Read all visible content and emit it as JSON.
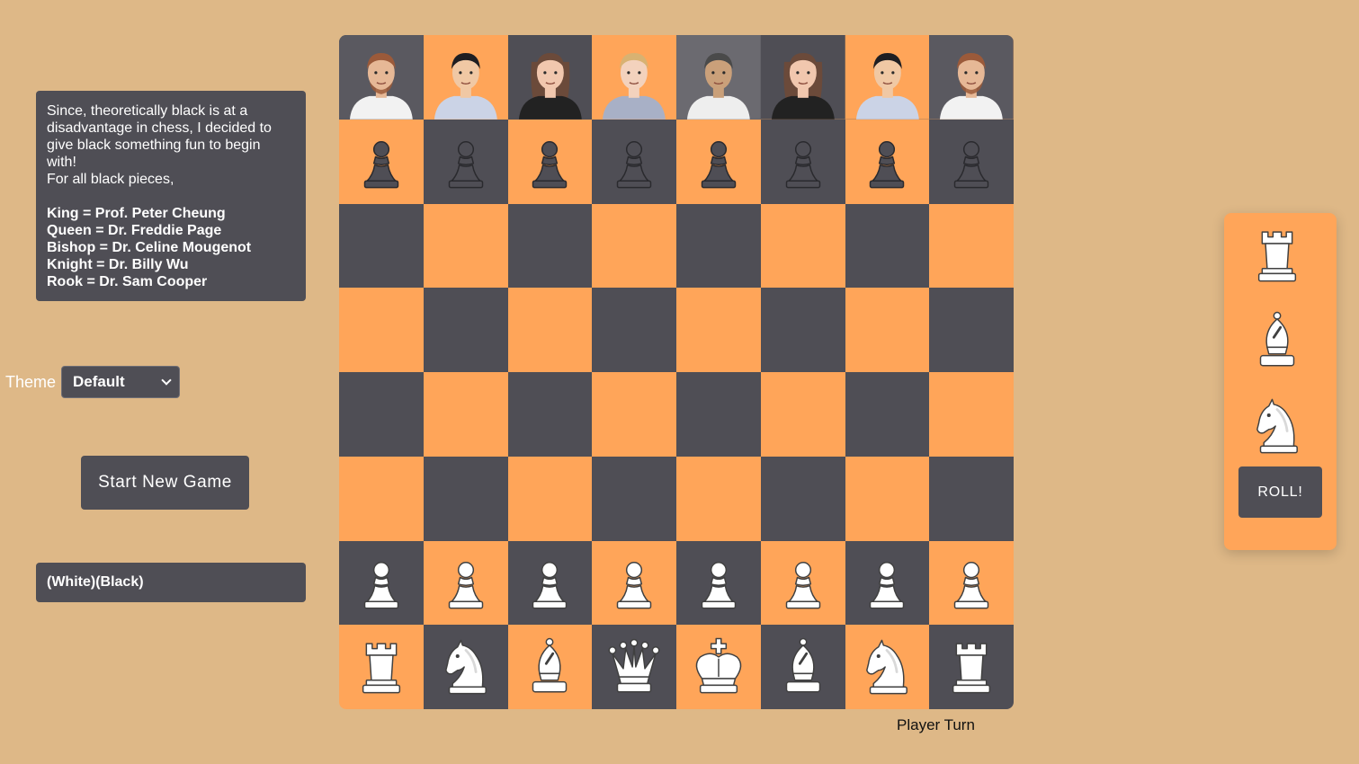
{
  "info": {
    "intro_lines": [
      "Since, theoretically black is at a",
      "disadvantage in chess, I decided to",
      "give black something fun to begin",
      "with!",
      "For all black pieces,"
    ],
    "mappings": [
      "King = Prof. Peter Cheung",
      "Queen = Dr. Freddie Page",
      "Bishop = Dr. Celine Mougenot",
      "Knight = Dr. Billy Wu",
      "Rook = Dr. Sam Cooper"
    ]
  },
  "theme": {
    "label": "Theme",
    "selected": "Default"
  },
  "start_button": "Start New Game",
  "status": "(White)(Black)",
  "turn": "Player Turn",
  "roll_button": "ROLL!",
  "roll_pieces": [
    "rook",
    "bishop",
    "knight"
  ],
  "board": [
    [
      "rook-portrait",
      "knight-portrait",
      "bishop-portrait",
      "queen-portrait",
      "king-portrait",
      "bishop-portrait",
      "knight-portrait",
      "rook-portrait"
    ],
    [
      "bp",
      "bp",
      "bp",
      "bp",
      "bp",
      "bp",
      "bp",
      "bp"
    ],
    [
      "",
      "",
      "",
      "",
      "",
      "",
      "",
      ""
    ],
    [
      "",
      "",
      "",
      "",
      "",
      "",
      "",
      ""
    ],
    [
      "",
      "",
      "",
      "",
      "",
      "",
      "",
      ""
    ],
    [
      "",
      "",
      "",
      "",
      "",
      "",
      "",
      ""
    ],
    [
      "wp",
      "wp",
      "wp",
      "wp",
      "wp",
      "wp",
      "wp",
      "wp"
    ],
    [
      "wr",
      "wn",
      "wb",
      "wq",
      "wk",
      "wb",
      "wn",
      "wr"
    ]
  ],
  "colors": {
    "background": "#deb887",
    "light_square": "#ffa559",
    "dark_square": "#4f4e55",
    "panel": "#4f4e55"
  }
}
